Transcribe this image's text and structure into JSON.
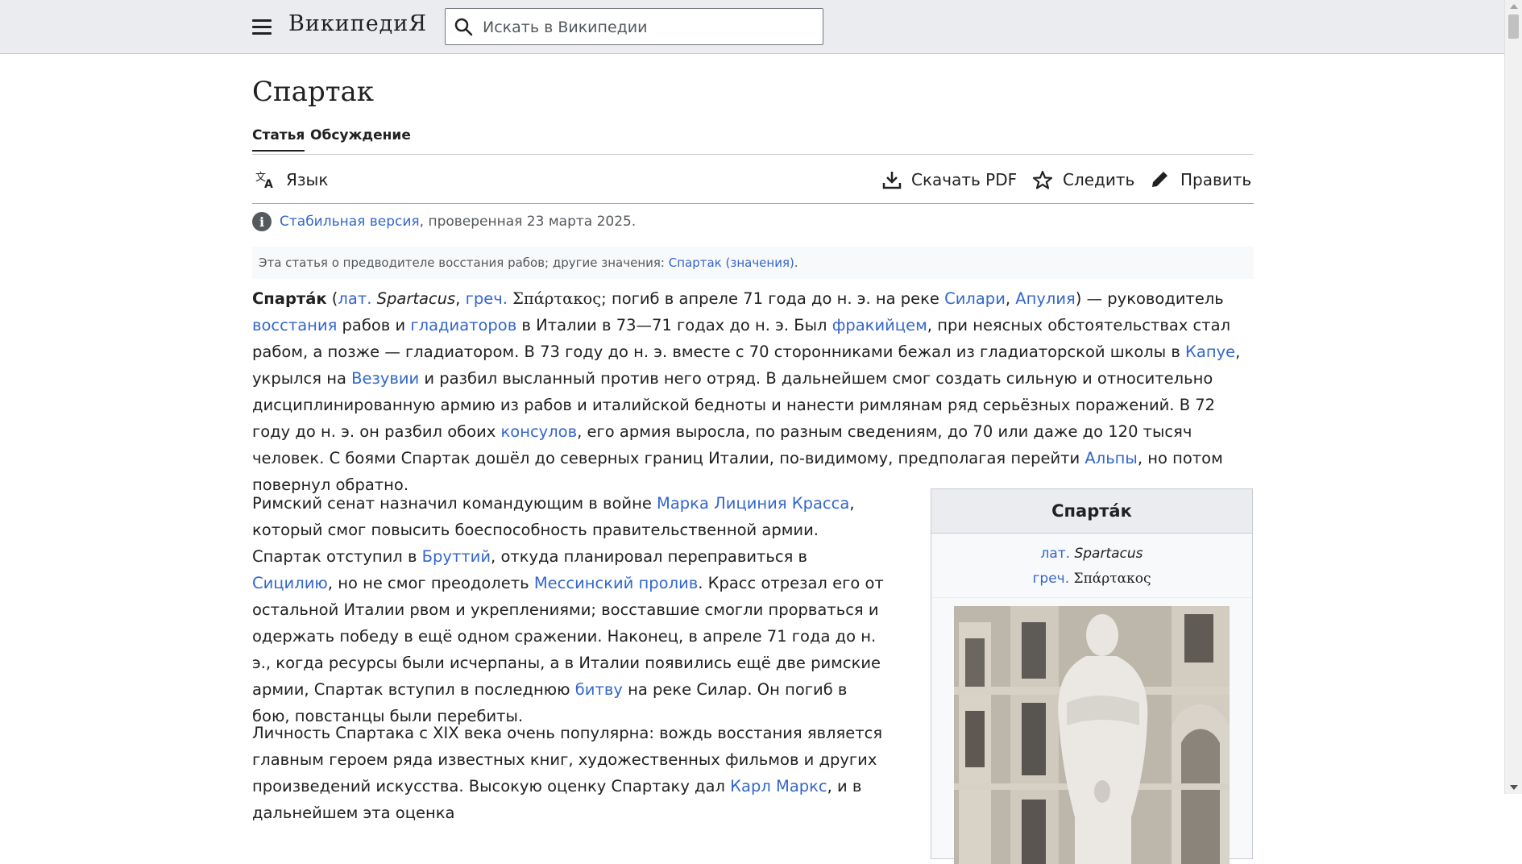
{
  "header": {
    "wordmark": "ВикипедиЯ",
    "search_placeholder": "Искать в Википедии"
  },
  "page": {
    "title": "Спартак",
    "tabs": [
      "Статья",
      "Обсуждение"
    ],
    "toolbar": {
      "language": "Язык",
      "download_pdf": "Скачать PDF",
      "watch": "Следить",
      "edit": "Править"
    },
    "stable": {
      "link": "Стабильная версия",
      "rest": ", проверенная 23 марта 2025."
    },
    "hatnote": {
      "text": "Эта статья о предводителе восстания рабов; другие значения: ",
      "link": "Спартак (значения)",
      "end": "."
    }
  },
  "infobox": {
    "title": "Спарта́к",
    "lat_label": "лат.",
    "lat_name": "Spartacus",
    "greek_label": "греч.",
    "greek_name": "Σπάρτακος"
  },
  "article": {
    "p1": [
      {
        "b": "Спарта́к"
      },
      {
        "t": " ("
      },
      {
        "a": "лат."
      },
      {
        "t": " "
      },
      {
        "i": "Spartacus"
      },
      {
        "t": ", "
      },
      {
        "a": "греч."
      },
      {
        "t": " "
      },
      {
        "g": "Σπάρτακος"
      },
      {
        "t": "; погиб в апреле 71 года до н. э. на реке "
      },
      {
        "a": "Силари"
      },
      {
        "t": ", "
      },
      {
        "a": "Апулия"
      },
      {
        "t": ") — руководитель "
      },
      {
        "a": "восстания"
      },
      {
        "t": " рабов и "
      },
      {
        "a": "гладиаторов"
      },
      {
        "t": " в Италии в 73—71 годах до н. э. Был "
      },
      {
        "a": "фракийцем"
      },
      {
        "t": ", при неясных обстоятельствах стал рабом, а позже — гладиатором. В 73 году до н. э. вместе с 70 сторонниками бежал из гладиаторской школы в "
      },
      {
        "a": "Капуе"
      },
      {
        "t": ", укрылся на "
      },
      {
        "a": "Везувии"
      },
      {
        "t": " и разбил высланный против него отряд. В дальнейшем смог создать сильную и относительно дисциплинированную армию из рабов и италийской бедноты и нанести римлянам ряд серьёзных поражений. В 72 году до н. э. он разбил обоих "
      },
      {
        "a": "консулов"
      },
      {
        "t": ", его армия выросла, по разным сведениям, до 70 или даже до 120 тысяч человек. С боями Спартак дошёл до северных границ Италии, по-видимому, предполагая перейти "
      },
      {
        "a": "Альпы"
      },
      {
        "t": ", но потом повернул обратно."
      }
    ],
    "p2": [
      {
        "t": "Римский сенат назначил командующим в войне "
      },
      {
        "a": "Марка Лициния Красса"
      },
      {
        "t": ", который смог повысить боеспособность правительственной армии. Спартак отступил в "
      },
      {
        "a": "Бруттий"
      },
      {
        "t": ", откуда планировал переправиться в "
      },
      {
        "a": "Сицилию"
      },
      {
        "t": ", но не смог преодолеть "
      },
      {
        "a": "Мессинский пролив"
      },
      {
        "t": ". Красс отрезал его от остальной Италии рвом и укреплениями; восставшие смогли прорваться и одержать победу в ещё одном сражении. Наконец, в апреле 71 года до н. э., когда ресурсы были исчерпаны, а в Италии появились ещё две римские армии, Спартак вступил в последнюю "
      },
      {
        "a": "битву"
      },
      {
        "t": " на реке Силар. Он погиб в бою, повстанцы были перебиты."
      }
    ],
    "p3": [
      {
        "t": "Личность Спартака с XIX века очень популярна: вождь восстания является главным героем ряда известных книг, художественных фильмов и других произведений искусства. Высокую оценку Спартаку дал "
      },
      {
        "a": "Карл Маркс"
      },
      {
        "t": ", и в дальнейшем эта оценка"
      }
    ]
  }
}
